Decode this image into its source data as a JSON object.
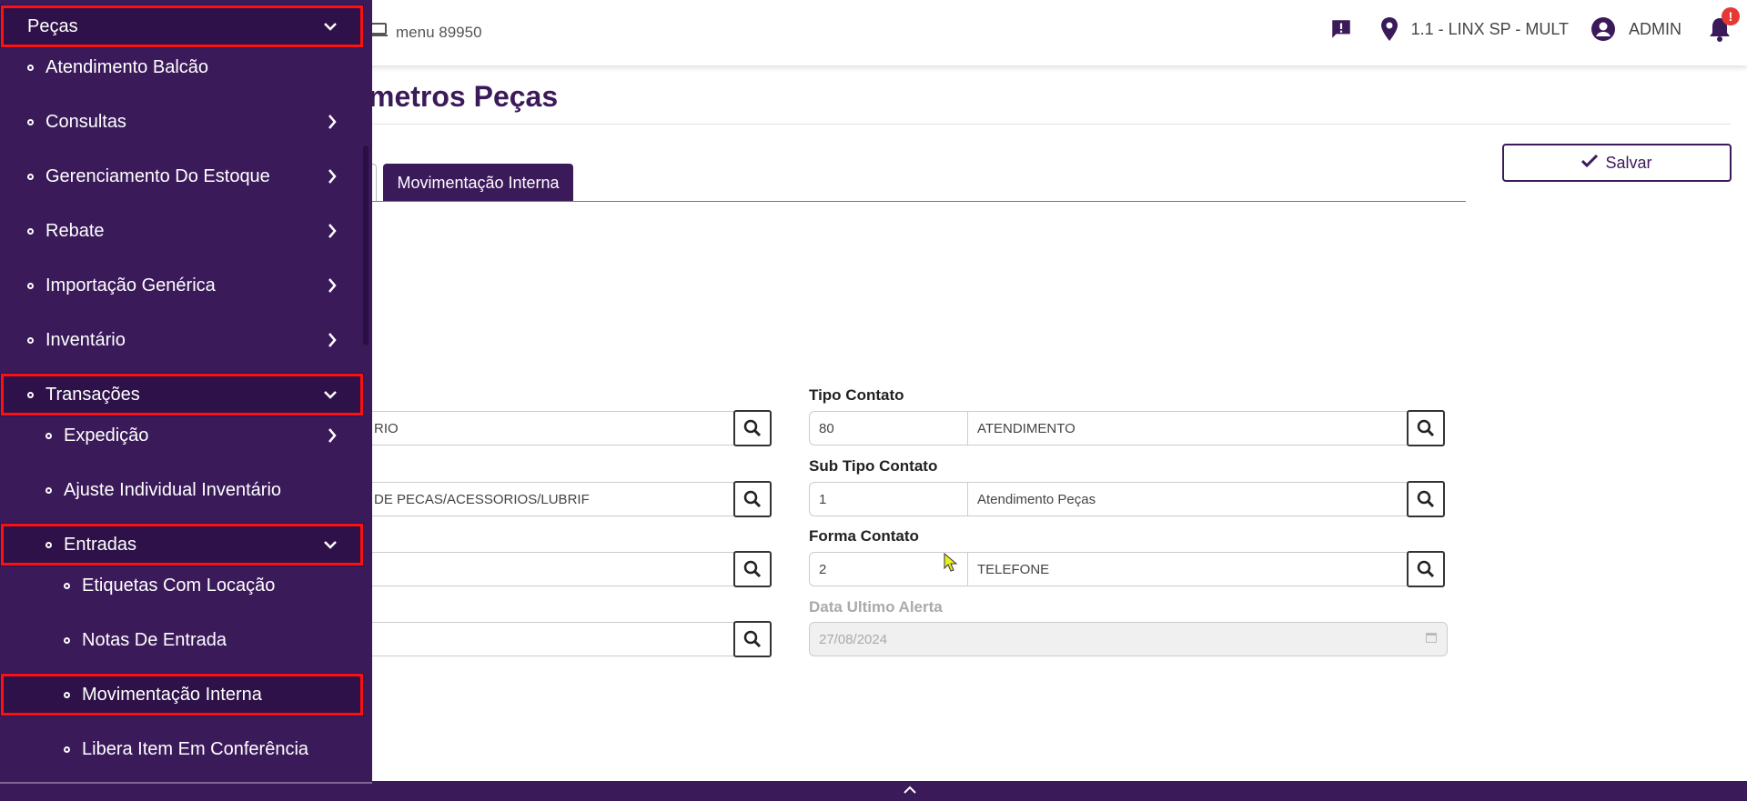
{
  "topbar": {
    "menu_label": "menu 89950",
    "location": "1.1 - LINX SP - MULT",
    "user": "ADMIN",
    "notification_badge": "!"
  },
  "page": {
    "title": "metros Peças",
    "save_label": "Salvar"
  },
  "tabs": {
    "active": "Movimentação Interna"
  },
  "form": {
    "left": {
      "row1_value": "RIO",
      "row2_value": "DE PECAS/ACESSORIOS/LUBRIF",
      "row3_value": "",
      "row4_value": ""
    },
    "tipo_contato": {
      "label": "Tipo Contato",
      "code": "80",
      "desc": "ATENDIMENTO"
    },
    "sub_tipo_contato": {
      "label": "Sub Tipo Contato",
      "code": "1",
      "desc": "Atendimento Peças"
    },
    "forma_contato": {
      "label": "Forma Contato",
      "code": "2",
      "desc": "TELEFONE"
    },
    "data_ultimo_alerta": {
      "label": "Data Ultimo Alerta",
      "value": "27/08/2024"
    }
  },
  "sidebar": {
    "items": [
      {
        "label": "Peças",
        "level": 0,
        "chevron": "down"
      },
      {
        "label": "Atendimento Balcão",
        "level": 1
      },
      {
        "label": "Consultas",
        "level": 1,
        "chevron": "right"
      },
      {
        "label": "Gerenciamento Do Estoque",
        "level": 1,
        "chevron": "right"
      },
      {
        "label": "Rebate",
        "level": 1,
        "chevron": "right"
      },
      {
        "label": "Importação Genérica",
        "level": 1,
        "chevron": "right"
      },
      {
        "label": "Inventário",
        "level": 1,
        "chevron": "right"
      },
      {
        "label": "Transações",
        "level": 1,
        "chevron": "down"
      },
      {
        "label": "Expedição",
        "level": 2,
        "chevron": "right"
      },
      {
        "label": "Ajuste Individual Inventário",
        "level": 2
      },
      {
        "label": "Entradas",
        "level": 2,
        "chevron": "down"
      },
      {
        "label": "Etiquetas Com Locação",
        "level": 3
      },
      {
        "label": "Notas De Entrada",
        "level": 3
      },
      {
        "label": "Movimentação Interna",
        "level": 3
      },
      {
        "label": "Libera Item Em Conferência",
        "level": 3
      }
    ]
  },
  "colors": {
    "brand": "#3b1a5a",
    "highlight": "#ff1010"
  }
}
